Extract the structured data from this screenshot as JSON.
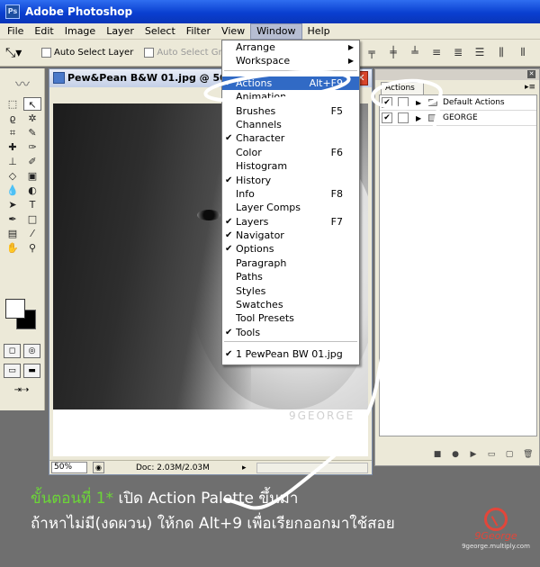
{
  "app": {
    "title": "Adobe Photoshop",
    "logo_text": "Ps"
  },
  "menubar": [
    "File",
    "Edit",
    "Image",
    "Layer",
    "Select",
    "Filter",
    "View",
    "Window",
    "Help"
  ],
  "options_bar": {
    "auto_select_layer": "Auto Select Layer",
    "auto_select_groups": "Auto Select Groups"
  },
  "document": {
    "title": "Pew&Pean B&W 01.jpg @ 50%",
    "watermark": "9GEORGE",
    "zoom": "50%",
    "doc_size": "Doc: 2.03M/2.03M"
  },
  "window_menu": {
    "items": [
      {
        "label": "Arrange",
        "checked": false,
        "shortcut": "",
        "submenu": true
      },
      {
        "label": "Workspace",
        "checked": false,
        "shortcut": "",
        "submenu": true
      },
      {
        "sep": true
      },
      {
        "label": "Actions",
        "checked": true,
        "shortcut": "Alt+F9",
        "submenu": false,
        "highlight": true
      },
      {
        "label": "Animation",
        "checked": false,
        "shortcut": "",
        "submenu": false
      },
      {
        "label": "Brushes",
        "checked": false,
        "shortcut": "F5",
        "submenu": false
      },
      {
        "label": "Channels",
        "checked": false,
        "shortcut": "",
        "submenu": false
      },
      {
        "label": "Character",
        "checked": true,
        "shortcut": "",
        "submenu": false
      },
      {
        "label": "Color",
        "checked": false,
        "shortcut": "F6",
        "submenu": false
      },
      {
        "label": "Histogram",
        "checked": false,
        "shortcut": "",
        "submenu": false
      },
      {
        "label": "History",
        "checked": true,
        "shortcut": "",
        "submenu": false
      },
      {
        "label": "Info",
        "checked": false,
        "shortcut": "F8",
        "submenu": false
      },
      {
        "label": "Layer Comps",
        "checked": false,
        "shortcut": "",
        "submenu": false
      },
      {
        "label": "Layers",
        "checked": true,
        "shortcut": "F7",
        "submenu": false
      },
      {
        "label": "Navigator",
        "checked": true,
        "shortcut": "",
        "submenu": false
      },
      {
        "label": "Options",
        "checked": true,
        "shortcut": "",
        "submenu": false
      },
      {
        "label": "Paragraph",
        "checked": false,
        "shortcut": "",
        "submenu": false
      },
      {
        "label": "Paths",
        "checked": false,
        "shortcut": "",
        "submenu": false
      },
      {
        "label": "Styles",
        "checked": false,
        "shortcut": "",
        "submenu": false
      },
      {
        "label": "Swatches",
        "checked": false,
        "shortcut": "",
        "submenu": false
      },
      {
        "label": "Tool Presets",
        "checked": false,
        "shortcut": "",
        "submenu": false
      },
      {
        "label": "Tools",
        "checked": true,
        "shortcut": "",
        "submenu": false
      },
      {
        "sep": true
      },
      {
        "label": "1 PewPean BW 01.jpg",
        "checked": true,
        "shortcut": "",
        "submenu": false
      }
    ]
  },
  "actions_panel": {
    "tab": "Actions",
    "rows": [
      {
        "label": "Default Actions",
        "checked": true
      },
      {
        "label": "GEORGE",
        "checked": true
      }
    ]
  },
  "caption": {
    "step": "ขั้นตอนที่ 1*",
    "line1": " เปิด Action Palette ขึ้นมา",
    "line2": "ถ้าหาไม่มี(งดผวน) ให้กด Alt+9 เพื่อเรียกออกมาใช้สอย"
  },
  "brand": {
    "name": "9George",
    "url": "9george.multiply.com"
  },
  "colors": {
    "highlight": "#316ac5",
    "caption_step": "#6cd638",
    "brand": "#e2463a"
  },
  "icons": {
    "tools": [
      "marquee-tool-icon",
      "move-tool-icon",
      "lasso-tool-icon",
      "magic-wand-tool-icon",
      "crop-tool-icon",
      "slice-tool-icon",
      "healing-brush-tool-icon",
      "brush-tool-icon",
      "clone-stamp-tool-icon",
      "history-brush-tool-icon",
      "eraser-tool-icon",
      "gradient-tool-icon",
      "blur-tool-icon",
      "dodge-tool-icon",
      "path-selection-tool-icon",
      "type-tool-icon",
      "pen-tool-icon",
      "shape-tool-icon",
      "notes-tool-icon",
      "eyedropper-tool-icon",
      "hand-tool-icon",
      "zoom-tool-icon"
    ]
  }
}
